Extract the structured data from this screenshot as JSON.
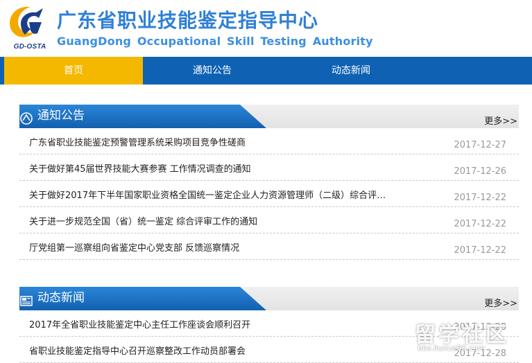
{
  "header": {
    "logo_text": "GD-OSTA",
    "title": "广东省职业技能鉴定指导中心",
    "subtitle": "GuangDong Occupational Skill Testing Authority"
  },
  "nav": {
    "items": [
      {
        "label": "首页",
        "active": true
      },
      {
        "label": "通知公告",
        "active": false
      },
      {
        "label": "动态新闻",
        "active": false
      }
    ]
  },
  "notices": {
    "title": "通知公告",
    "more_label": "更多>>",
    "items": [
      {
        "title": "广东省职业技能鉴定预警管理系统采购项目竞争性磋商",
        "date": "2017-12-27"
      },
      {
        "title": "关于做好第45届世界技能大赛参赛 工作情况调查的通知",
        "date": "2017-12-26"
      },
      {
        "title": "关于做好2017年下半年国家职业资格全国统一鉴定企业人力资源管理师（二级）综合评…",
        "date": "2017-12-22"
      },
      {
        "title": "关于进一步规范全国（省）统一鉴定 综合评审工作的通知",
        "date": "2017-12-22"
      },
      {
        "title": "厅党组第一巡察组向省鉴定中心党支部 反馈巡察情况",
        "date": "2017-12-22"
      }
    ]
  },
  "news": {
    "title": "动态新闻",
    "more_label": "更多>>",
    "items": [
      {
        "title": "2017年全省职业技能鉴定中心主任工作座谈会顺利召开",
        "date": "2017-12-28"
      },
      {
        "title": "省职业技能鉴定指导中心召开巡察整改工作动员部署会",
        "date": "2017-12-28"
      }
    ]
  },
  "watermark": {
    "text": "留学社区",
    "url": "bbs.liuxue86.com"
  },
  "colors": {
    "nav_bg": "#0f62b3",
    "nav_active": "#f5b800",
    "title_blue": "#2f80d6",
    "tab_blue": "#1a6fc4"
  }
}
